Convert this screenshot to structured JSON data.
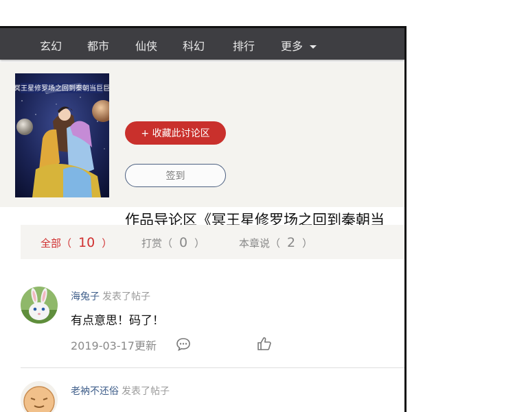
{
  "nav": {
    "items": [
      "玄幻",
      "都市",
      "仙侠",
      "科幻",
      "排行",
      "更多"
    ]
  },
  "header": {
    "cover_text": "冥王星修罗场之回到秦朝当巨巨",
    "collect_label": "+ 收藏此讨论区",
    "checkin_label": "签到",
    "title": "作品导论区《冥王星修罗场之回到秦朝当"
  },
  "tabs": [
    {
      "label": "全部（",
      "count": "10",
      "close": "）",
      "active": true
    },
    {
      "label": "打赏（",
      "count": "0",
      "close": "）",
      "active": false
    },
    {
      "label": "本章说（",
      "count": "2",
      "close": "）",
      "active": false
    }
  ],
  "posts": [
    {
      "user": "海兔子",
      "action": "发表了帖子",
      "content": "有点意思！码了！",
      "date": "2019-03-17更新",
      "avatar_icon": "rabbit-avatar-icon"
    },
    {
      "user": "老衲不还俗",
      "action": "发表了帖子",
      "avatar_icon": "face-avatar-icon"
    }
  ],
  "colors": {
    "nav_bg": "#3e3e42",
    "accent_red": "#c9302c",
    "username_blue": "#3f5e8a"
  }
}
